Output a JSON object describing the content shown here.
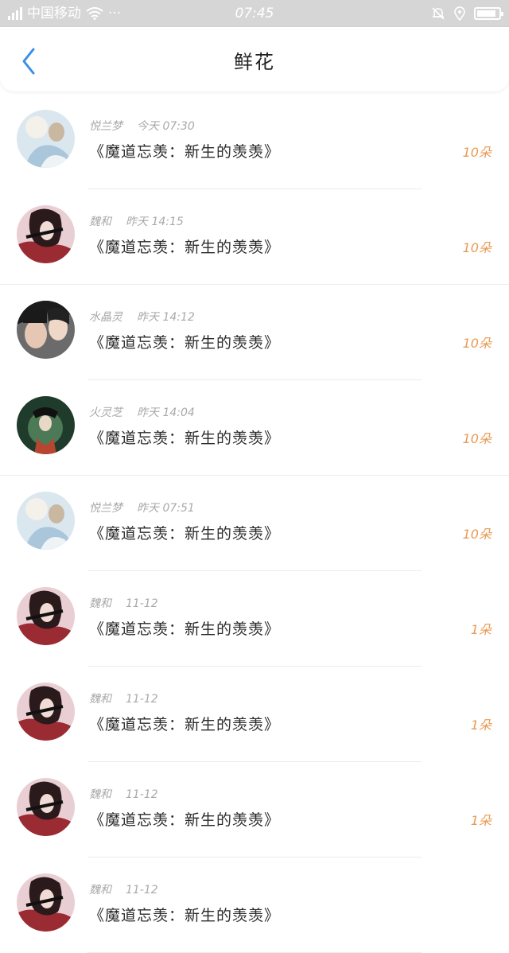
{
  "status_bar": {
    "carrier": "中国移动",
    "more": "···",
    "time": "07:45",
    "battery_level": 0.9
  },
  "header": {
    "title": "鲜花",
    "back_icon": "chevron-left-icon",
    "accent_color": "#3b8ee8"
  },
  "list": [
    {
      "name": "悦兰梦",
      "time": "今天 07:30",
      "book": "《魔道忘羡：新生的羡羡》",
      "amount": "10朵",
      "avatar": "light"
    },
    {
      "name": "魏和",
      "time": "昨天 14:15",
      "book": "《魔道忘羡：新生的羡羡》",
      "amount": "10朵",
      "avatar": "red"
    },
    {
      "name": "水晶灵",
      "time": "昨天 14:12",
      "book": "《魔道忘羡：新生的羡羡》",
      "amount": "10朵",
      "avatar": "dark"
    },
    {
      "name": "火灵芝",
      "time": "昨天 14:04",
      "book": "《魔道忘羡：新生的羡羡》",
      "amount": "10朵",
      "avatar": "green"
    },
    {
      "name": "悦兰梦",
      "time": "昨天 07:51",
      "book": "《魔道忘羡：新生的羡羡》",
      "amount": "10朵",
      "avatar": "light"
    },
    {
      "name": "魏和",
      "time": "11-12",
      "book": "《魔道忘羡：新生的羡羡》",
      "amount": "1朵",
      "avatar": "red"
    },
    {
      "name": "魏和",
      "time": "11-12",
      "book": "《魔道忘羡：新生的羡羡》",
      "amount": "1朵",
      "avatar": "red"
    },
    {
      "name": "魏和",
      "time": "11-12",
      "book": "《魔道忘羡：新生的羡羡》",
      "amount": "1朵",
      "avatar": "red"
    },
    {
      "name": "魏和",
      "time": "11-12",
      "book": "《魔道忘羡：新生的羡羡》",
      "amount": "",
      "avatar": "red"
    }
  ]
}
